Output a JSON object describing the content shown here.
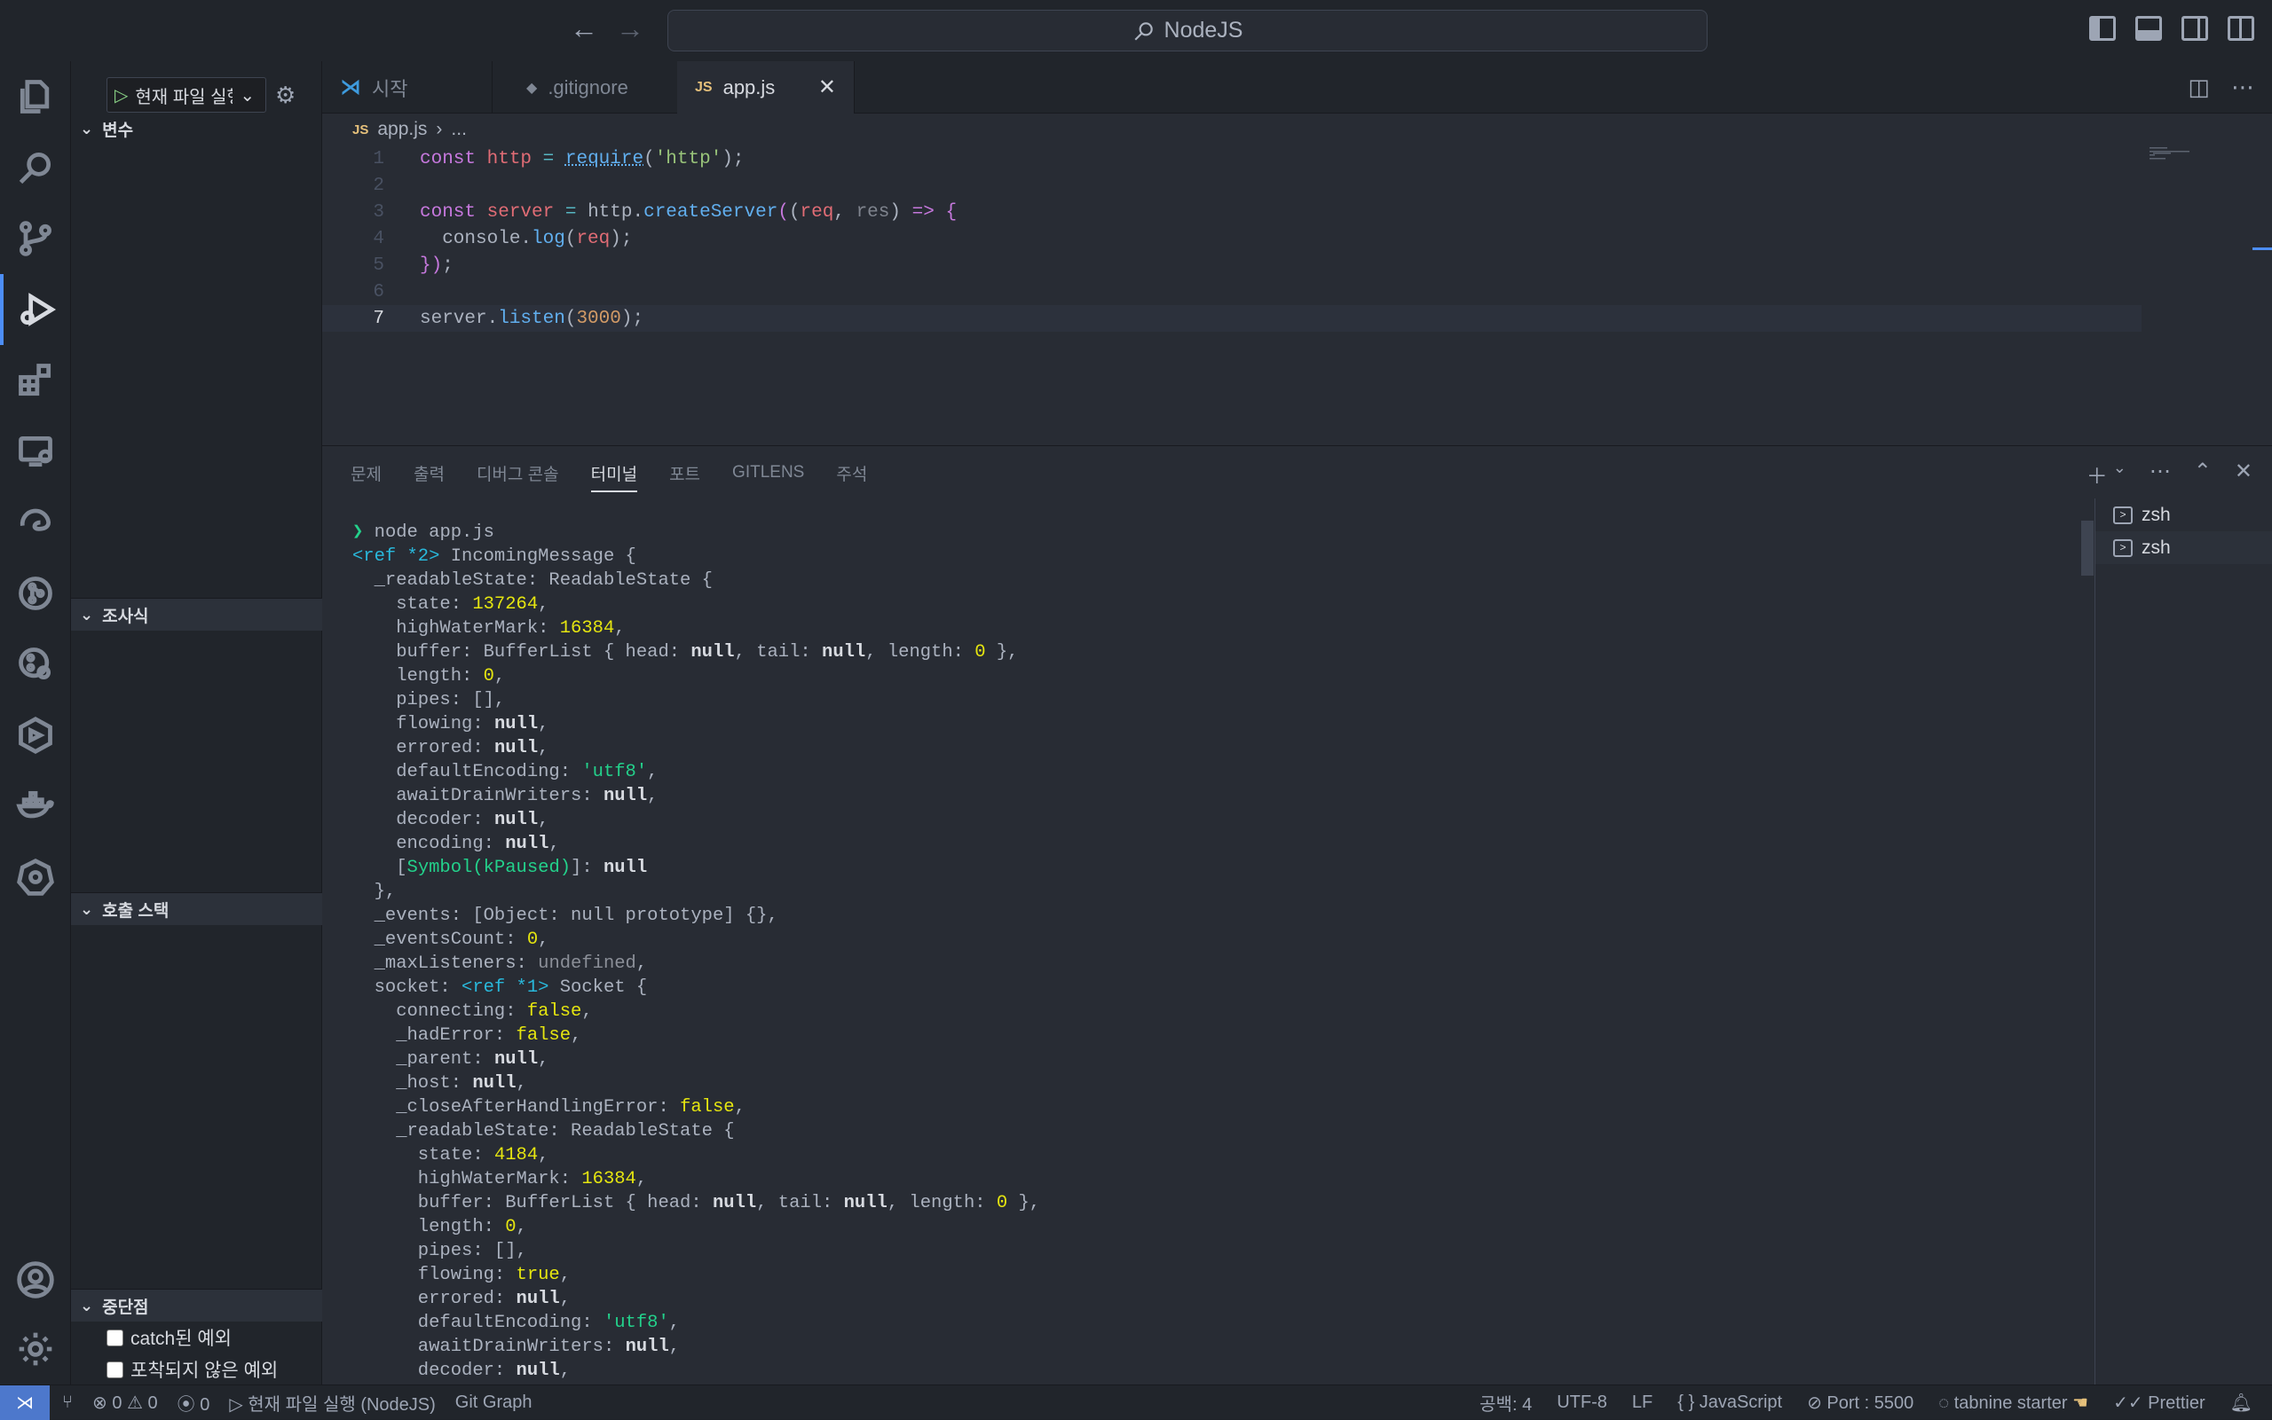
{
  "titlebar": {
    "search_text": "NodeJS"
  },
  "debug": {
    "config_label": "현재 파일 실행"
  },
  "sidebar": {
    "variables": "변수",
    "watch": "조사식",
    "callstack": "호출 스택",
    "breakpoints": "중단점",
    "bp_items": [
      "catch된 예외",
      "포착되지 않은 예외"
    ]
  },
  "tabs": [
    {
      "label": "시작",
      "icon": "vscode-icon"
    },
    {
      "label": ".gitignore",
      "icon": "git-icon"
    },
    {
      "label": "app.js",
      "icon": "js-icon"
    }
  ],
  "breadcrumb": {
    "file": "app.js",
    "rest": "..."
  },
  "editor": {
    "line_numbers": [
      "1",
      "2",
      "3",
      "4",
      "5",
      "6",
      "7"
    ]
  },
  "panel": {
    "tabs": [
      "문제",
      "출력",
      "디버그 콘솔",
      "터미널",
      "포트",
      "GITLENS",
      "주석"
    ],
    "active_tab": "터미널",
    "terminals": [
      "zsh",
      "zsh"
    ]
  },
  "statusbar": {
    "errors": "0",
    "warnings": "0",
    "ports": "0",
    "debug_label": "현재 파일 실행 (NodeJS)",
    "git_graph": "Git Graph",
    "spaces": "공백: 4",
    "encoding": "UTF-8",
    "eol": "LF",
    "language": "JavaScript",
    "port": "Port : 5500",
    "tabnine": "tabnine starter",
    "prettier": "Prettier"
  },
  "colors": {
    "accent": "#4d8ef7",
    "remote": "#4d78cc",
    "bg": "#282c34"
  }
}
